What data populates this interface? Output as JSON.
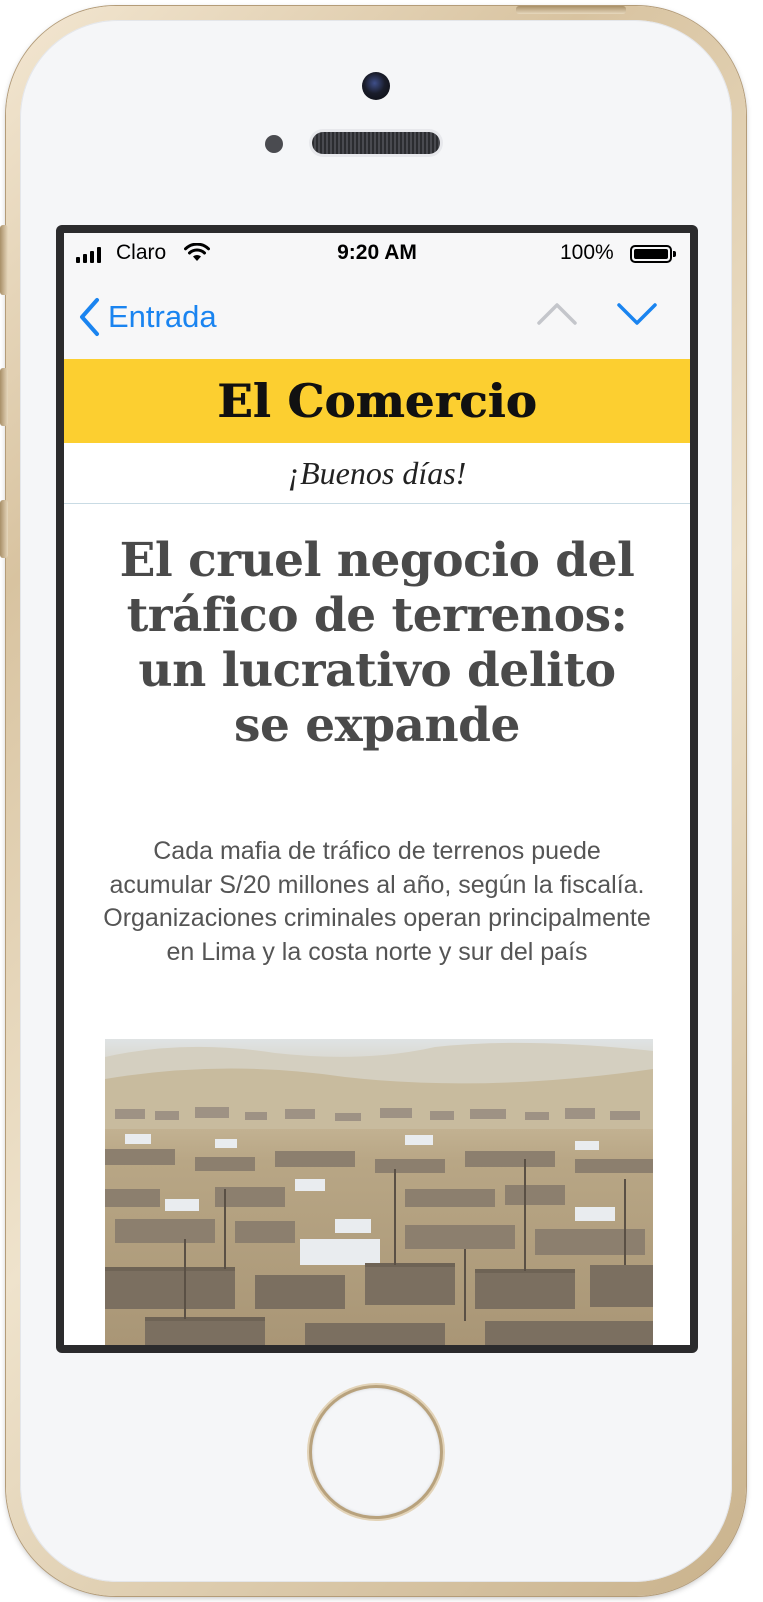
{
  "status_bar": {
    "carrier": "Claro",
    "time": "9:20 AM",
    "battery": "100%"
  },
  "nav": {
    "back_label": "Entrada"
  },
  "email": {
    "brand": "El Comercio",
    "greeting": "¡Buenos días!",
    "headline": "El cruel negocio del tráfico de terrenos: un lucrativo delito se expande",
    "summary": "Cada mafia de tráfico de terrenos puede acumular S/20 millones al año, según la fiscalía. Organizaciones criminales operan principalmente en Lima y la costa norte y sur del país"
  },
  "colors": {
    "banner": "#fccf30",
    "link_blue": "#1a84f0"
  },
  "icons": [
    "signal-icon",
    "wifi-icon",
    "battery-icon",
    "chevron-left-icon",
    "chevron-up-icon",
    "chevron-down-icon"
  ]
}
